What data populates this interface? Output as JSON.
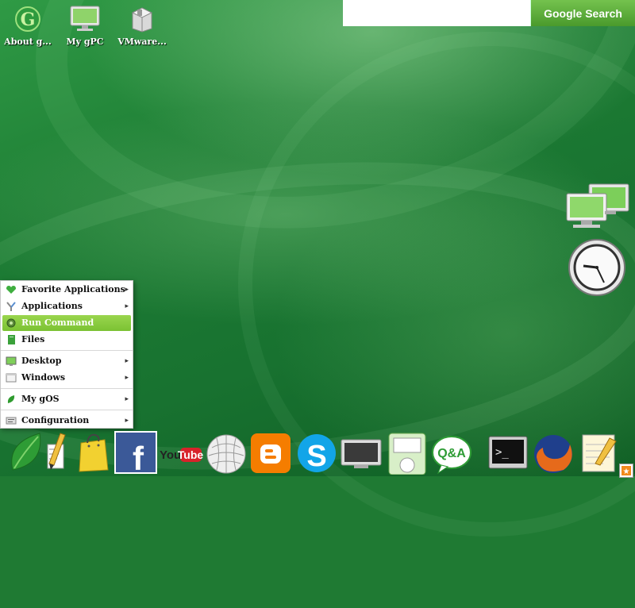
{
  "desktop_icons": [
    {
      "label": "About g...",
      "icon": "gos-logo-icon"
    },
    {
      "label": "My gPC",
      "icon": "monitor-icon"
    },
    {
      "label": "VMware...",
      "icon": "package-box-icon"
    }
  ],
  "search": {
    "value": "",
    "button_label": "Google Search"
  },
  "widgets": {
    "network": "network-computers-icon",
    "clock": "analog-clock-icon"
  },
  "start_menu": {
    "items": [
      {
        "label": "Favorite Applications",
        "icon": "heart-icon",
        "submenu": true
      },
      {
        "label": "Applications",
        "icon": "tools-icon",
        "submenu": true
      },
      {
        "label": "Run Command",
        "icon": "gear-icon",
        "submenu": false,
        "active": true
      },
      {
        "label": "Files",
        "icon": "file-icon",
        "submenu": false
      },
      {
        "label": "Desktop",
        "icon": "desktop-icon",
        "submenu": true
      },
      {
        "label": "Windows",
        "icon": "window-icon",
        "submenu": true
      },
      {
        "label": "My gOS",
        "icon": "leaf-icon",
        "submenu": true
      },
      {
        "label": "Configuration",
        "icon": "settings-icon",
        "submenu": true
      }
    ],
    "submenu_arrow": "▸"
  },
  "dock": {
    "items": [
      "gos-leaf-icon",
      "drawing-pencil-icon",
      "shopping-bag-icon",
      "facebook-icon",
      "youtube-icon",
      "wikipedia-icon",
      "blogger-icon",
      "skype-icon",
      "tv-icon",
      "ipod-icon",
      "qa-icon",
      "terminal-icon",
      "firefox-icon",
      "notepad-icon"
    ],
    "youtube_text": "You Tube",
    "facebook_letter": "f",
    "skype_letter": "S",
    "blogger_letter": "B",
    "qa_text": "Q&A",
    "terminal_prompt": ">_"
  },
  "colors": {
    "accent": "#7bc233",
    "desktop": "#1f7a33"
  }
}
